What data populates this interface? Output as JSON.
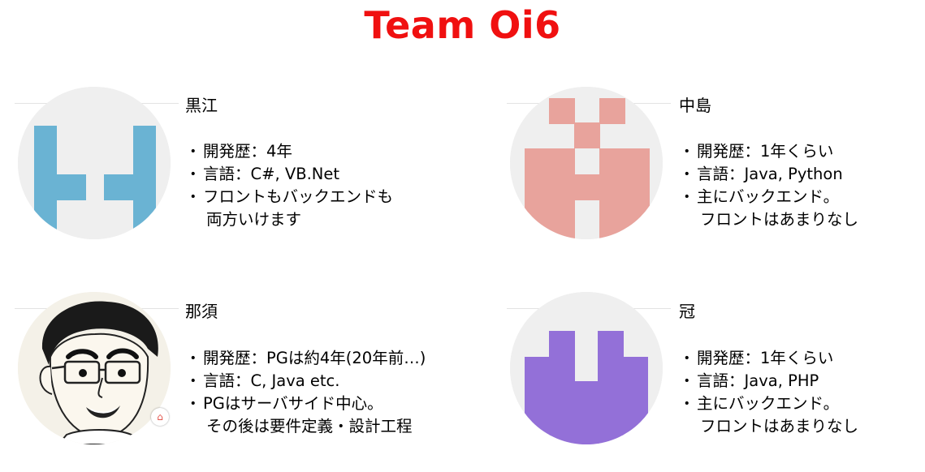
{
  "title": "Team Oi6",
  "members": [
    {
      "name": "黒江",
      "avatar_icon": "blue-pixel-identicon",
      "avatar_color": "#6ab3d3",
      "bullets": [
        {
          "text": "開発歴：4年"
        },
        {
          "text": "言語：C#, VB.Net"
        },
        {
          "text": "フロントもバックエンドも",
          "cont": "両方いけます"
        }
      ]
    },
    {
      "name": "中島",
      "avatar_icon": "pink-pixel-identicon",
      "avatar_color": "#e8a39c",
      "bullets": [
        {
          "text": "開発歴：1年くらい"
        },
        {
          "text": "言語：Java, Python"
        },
        {
          "text": "主にバックエンド。",
          "cont": "フロントはあまりなし"
        }
      ]
    },
    {
      "name": "那須",
      "avatar_icon": "cartoon-portrait",
      "bullets": [
        {
          "text": "開発歴：PGは約4年(20年前…)"
        },
        {
          "text": "言語：C, Java etc."
        },
        {
          "text": "PGはサーバサイド中心。",
          "cont": "その後は要件定義・設計工程"
        }
      ]
    },
    {
      "name": "冠",
      "avatar_icon": "purple-pixel-identicon",
      "avatar_color": "#9370d8",
      "bullets": [
        {
          "text": "開発歴：1年くらい"
        },
        {
          "text": "言語：Java, PHP"
        },
        {
          "text": "主にバックエンド。",
          "cont": "フロントはあまりなし"
        }
      ]
    }
  ]
}
